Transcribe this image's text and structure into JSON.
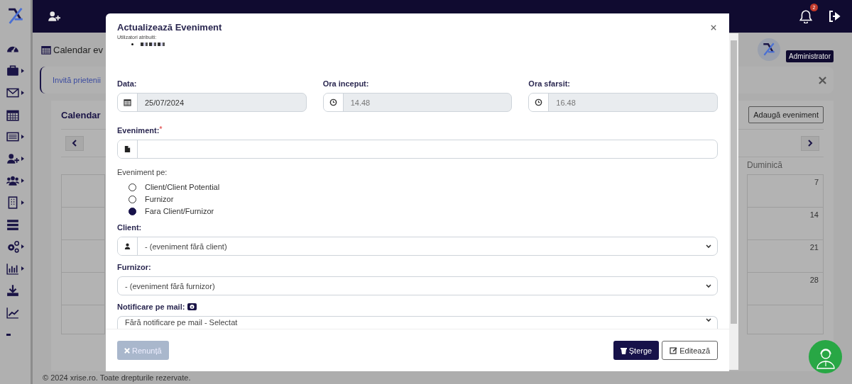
{
  "sidebar": {
    "items": [
      {
        "has_submenu": false
      },
      {
        "has_submenu": true
      },
      {
        "has_submenu": true
      },
      {
        "has_submenu": false
      },
      {
        "has_submenu": true
      },
      {
        "has_submenu": true
      },
      {
        "has_submenu": true
      },
      {
        "has_submenu": true
      },
      {
        "has_submenu": false
      },
      {
        "has_submenu": true
      },
      {
        "has_submenu": true
      },
      {
        "has_submenu": false
      },
      {
        "has_submenu": false
      },
      {
        "has_submenu": false
      }
    ]
  },
  "topbar": {
    "notification_count": "2"
  },
  "user": {
    "role": "Administrator"
  },
  "page": {
    "title": "Calendar ev",
    "invite_link": "Invită prietenii",
    "calendar_title": "Calendar",
    "add_button": "Adaugă eveniment",
    "day_header": "Duminică",
    "dates": [
      "7",
      "14",
      "21",
      "28"
    ],
    "footer": "© 2024 xrise.ro. Toate drepturile rezervate."
  },
  "modal": {
    "title": "Actualizează Eveniment",
    "assigned_label": "Utilizatori atribuiti:",
    "date": {
      "label": "Data:",
      "value": "25/07/2024"
    },
    "start": {
      "label": "Ora inceput:",
      "value": "14.48"
    },
    "end": {
      "label": "Ora sfarsit:",
      "value": "16.48"
    },
    "event": {
      "label": "Eveniment:",
      "required_marker": "*"
    },
    "event_on": {
      "label": "Eveniment pe:",
      "options": [
        {
          "label": "Client/Client Potential",
          "selected": false
        },
        {
          "label": "Furnizor",
          "selected": false
        },
        {
          "label": "Fara Client/Furnizor",
          "selected": true
        }
      ]
    },
    "client": {
      "label": "Client:",
      "value": "- (eveniment fără client)"
    },
    "supplier": {
      "label": "Furnizor:",
      "value": "- (eveniment fără furnizor)"
    },
    "notification": {
      "label": "Notificare pe mail:",
      "value": "Fără notificare pe mail - Selectat"
    },
    "buttons": {
      "cancel": {
        "label": "Renunță",
        "disabled": true
      },
      "delete": {
        "label": "Șterge"
      },
      "edit": {
        "label": "Editează"
      }
    }
  }
}
